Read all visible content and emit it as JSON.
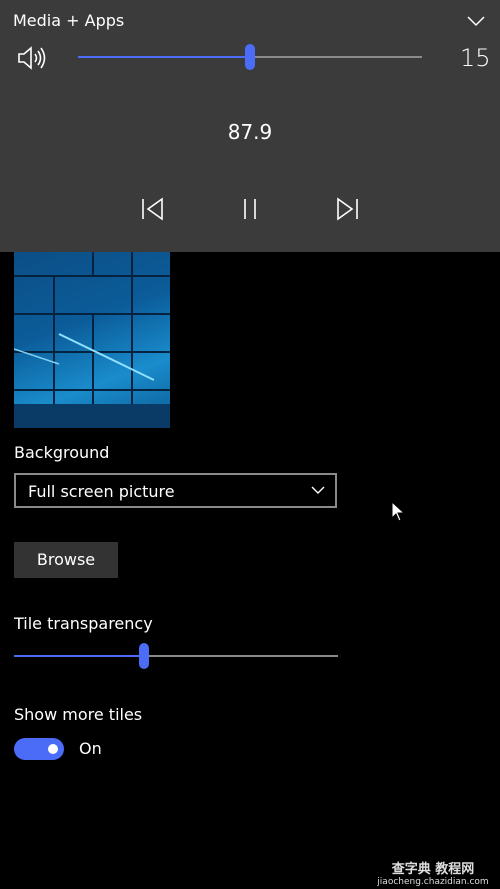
{
  "media_panel": {
    "title": "Media + Apps",
    "collapse_icon": "chevron-down-icon",
    "volume_icon": "speaker-icon",
    "volume_level": 15,
    "volume_fraction": 0.5,
    "volume_label": "15",
    "station": "87.9",
    "controls": [
      "previous-icon",
      "pause-icon",
      "next-icon"
    ]
  },
  "settings": {
    "background_label": "Background",
    "background_value": "Full screen picture",
    "browse_label": "Browse",
    "tile_transparency_label": "Tile transparency",
    "tile_transparency_fraction": 0.4,
    "show_more_tiles_label": "Show more tiles",
    "show_more_tiles_state": "On"
  },
  "colors": {
    "accent": "#4a6cf7",
    "panel": "#3b3b3b",
    "background": "#000000"
  },
  "watermark": {
    "line1": "查字典 教程网",
    "line2": "jiaocheng.chazidian.com"
  }
}
